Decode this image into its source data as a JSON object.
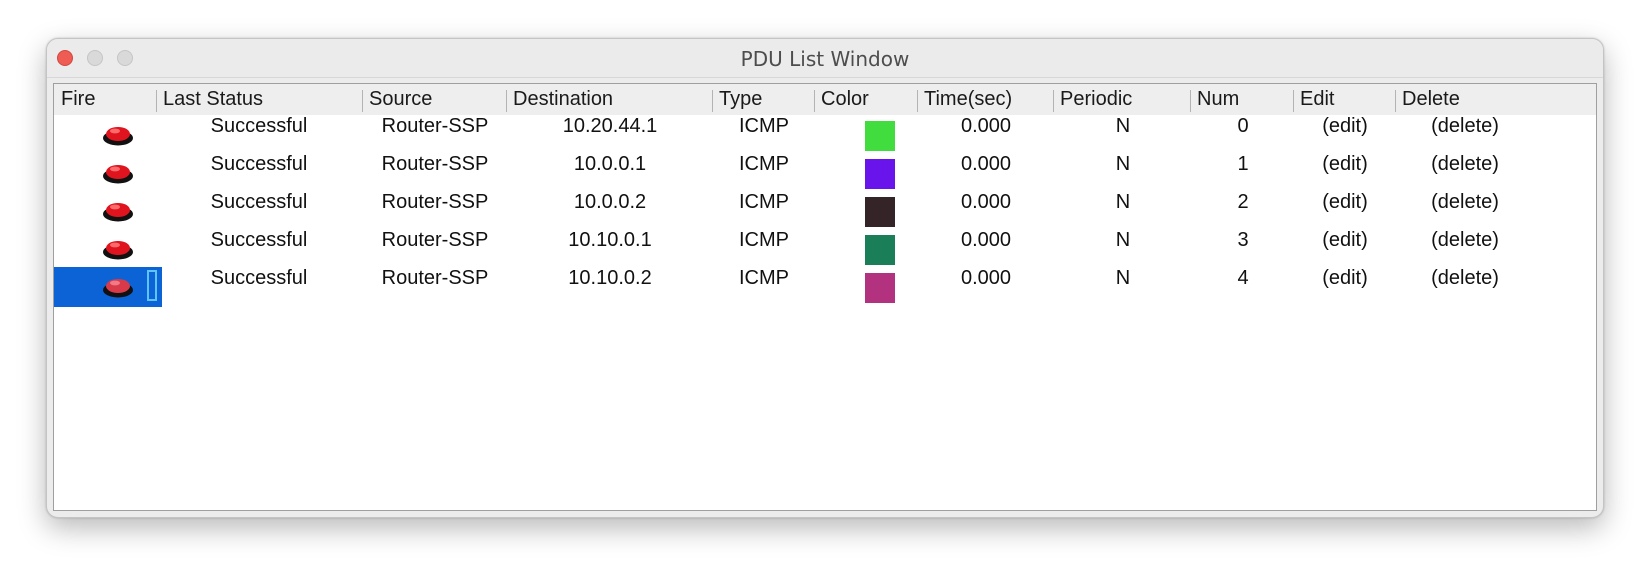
{
  "window": {
    "title": "PDU List Window"
  },
  "columns": [
    "Fire",
    "Last Status",
    "Source",
    "Destination",
    "Type",
    "Color",
    "Time(sec)",
    "Periodic",
    "Num",
    "Edit",
    "Delete"
  ],
  "rows": [
    {
      "status": "Successful",
      "source": "Router-SSP",
      "destination": "10.20.44.1",
      "type": "ICMP",
      "color": "#41dc3d",
      "time": "0.000",
      "periodic": "N",
      "num": "0",
      "edit": "(edit)",
      "delete": "(delete)",
      "selected": false
    },
    {
      "status": "Successful",
      "source": "Router-SSP",
      "destination": "10.0.0.1",
      "type": "ICMP",
      "color": "#6a14ec",
      "time": "0.000",
      "periodic": "N",
      "num": "1",
      "edit": "(edit)",
      "delete": "(delete)",
      "selected": false
    },
    {
      "status": "Successful",
      "source": "Router-SSP",
      "destination": "10.0.0.2",
      "type": "ICMP",
      "color": "#342427",
      "time": "0.000",
      "periodic": "N",
      "num": "2",
      "edit": "(edit)",
      "delete": "(delete)",
      "selected": false
    },
    {
      "status": "Successful",
      "source": "Router-SSP",
      "destination": "10.10.0.1",
      "type": "ICMP",
      "color": "#1a7f58",
      "time": "0.000",
      "periodic": "N",
      "num": "3",
      "edit": "(edit)",
      "delete": "(delete)",
      "selected": false
    },
    {
      "status": "Successful",
      "source": "Router-SSP",
      "destination": "10.10.0.2",
      "type": "ICMP",
      "color": "#b3327f",
      "time": "0.000",
      "periodic": "N",
      "num": "4",
      "edit": "(edit)",
      "delete": "(delete)",
      "selected": true
    }
  ],
  "icons": {
    "fire": "fire-button-icon",
    "close": "close-icon",
    "minimize": "minimize-icon",
    "maximize": "maximize-icon"
  }
}
